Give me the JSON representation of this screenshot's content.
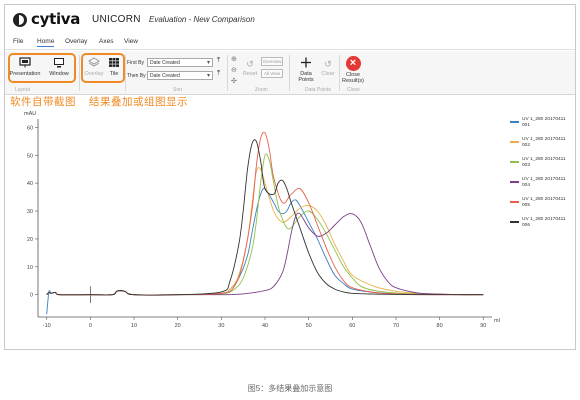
{
  "app": {
    "brand": "cytiva",
    "product": "UNICORN",
    "document_title": "Evaluation - New Comparison"
  },
  "menu": [
    "File",
    "Home",
    "Overlay",
    "Axes",
    "View"
  ],
  "ribbon": {
    "presentation_label": "Presentation",
    "window_label": "Window",
    "overlay_label": "Overlay",
    "tile_label": "Tile",
    "first_by_label": "First By",
    "first_by_value": "Date Created",
    "then_by_label": "Then By",
    "then_by_value": "Date Created",
    "reset_label": "Reset",
    "overview_label": "Overview",
    "all_view_label": "All View",
    "data_points_label": "Data Points",
    "clear_label": "Clear",
    "close_results_label": "Close Result(s)",
    "group_zoom": "Zoom",
    "group_data_points": "Data Points",
    "group_close": "Close",
    "group_layout": "Layout",
    "group_sort": "Sort"
  },
  "annotations": {
    "left": "软件自带截图",
    "right": "结果叠加或组图显示"
  },
  "caption": "图5：多结果叠加示意图",
  "colors": {
    "accent_orange": "#f08a24",
    "close_red": "#e53935"
  },
  "icons": [
    "presentation-icon",
    "monitor-icon",
    "layers-icon",
    "grid-icon",
    "sort-icon",
    "zoom-in-icon",
    "zoom-out-icon",
    "pan-icon",
    "reset-icon",
    "data-points-icon",
    "clear-icon",
    "close-icon"
  ],
  "chart_data": {
    "type": "line",
    "ylabel": "mAU",
    "xlabel": "ml",
    "xlim": [
      -12,
      92
    ],
    "ylim": [
      -8,
      63
    ],
    "xticks": [
      -10,
      0,
      10,
      20,
      30,
      40,
      50,
      60,
      70,
      80,
      90
    ],
    "yticks": [
      0,
      10,
      20,
      30,
      40,
      50,
      60
    ],
    "grid": false,
    "legend_position": "right",
    "series": [
      {
        "name": "UV 1_280 20170411 001",
        "color": "#3d7fc2",
        "x": [
          -10,
          -9.5,
          -9,
          -8,
          -7,
          0,
          5,
          6,
          7,
          8,
          10,
          20,
          30,
          32,
          34,
          36,
          37,
          38,
          39,
          40,
          42,
          43,
          44,
          45,
          46,
          47,
          48,
          50,
          52,
          54,
          56,
          58,
          60,
          65,
          70,
          75,
          80,
          85,
          90
        ],
        "y": [
          -7,
          1,
          0.5,
          0.8,
          0,
          0,
          0,
          1.2,
          1.5,
          1.1,
          0,
          0,
          0.5,
          2,
          6,
          14,
          22,
          30,
          36,
          38,
          33,
          30,
          29,
          30,
          33,
          34,
          32,
          26,
          20,
          13,
          7,
          4,
          2,
          0.8,
          0.4,
          0.2,
          0.1,
          0,
          0
        ]
      },
      {
        "name": "UV 1_280 20170411 002",
        "color": "#e9b04a",
        "x": [
          -10,
          -9.5,
          -9,
          -8,
          -7,
          0,
          5,
          6,
          7,
          8,
          10,
          20,
          30,
          32,
          34,
          36,
          37,
          38,
          39,
          40,
          42,
          44,
          46,
          48,
          50,
          52,
          54,
          56,
          58,
          60,
          65,
          70,
          75,
          80,
          85,
          90
        ],
        "y": [
          0,
          0.8,
          0.5,
          0.8,
          0,
          0,
          0,
          1.2,
          1.5,
          1.1,
          0,
          0,
          0.5,
          2,
          7,
          20,
          32,
          44,
          45,
          40,
          30,
          26,
          28,
          31,
          32,
          30,
          25,
          18,
          12,
          7,
          3,
          1.2,
          0.5,
          0.2,
          0,
          0
        ]
      },
      {
        "name": "UV 1_280 20170411 003",
        "color": "#8bc34a",
        "x": [
          -10,
          -9.5,
          -9,
          -8,
          -7,
          0,
          5,
          6,
          7,
          8,
          10,
          20,
          30,
          33,
          35,
          37,
          38,
          39,
          40,
          41,
          42,
          43,
          44,
          45,
          46,
          48,
          50,
          52,
          54,
          56,
          58,
          60,
          62,
          65,
          70,
          75,
          80,
          85,
          90
        ],
        "y": [
          0,
          0.8,
          0.5,
          0.8,
          0,
          0,
          0,
          1.2,
          1.5,
          1.1,
          0,
          0,
          0.3,
          2,
          6,
          16,
          26,
          40,
          50,
          48,
          40,
          32,
          27,
          24,
          24,
          28,
          30,
          27,
          22,
          16,
          10,
          6,
          3,
          1.5,
          0.6,
          0.2,
          0.1,
          0,
          0
        ]
      },
      {
        "name": "UV 1_280 20170411 004",
        "color": "#7b3f8c",
        "x": [
          -10,
          -9.5,
          -9,
          -8,
          -7,
          0,
          5,
          6,
          7,
          8,
          10,
          20,
          30,
          35,
          40,
          42,
          44,
          45,
          46,
          47,
          48,
          50,
          52,
          54,
          56,
          58,
          60,
          62,
          64,
          66,
          68,
          70,
          75,
          80,
          85,
          90
        ],
        "y": [
          0,
          0.8,
          0.5,
          0.8,
          0,
          0,
          0,
          1.2,
          1.5,
          1.1,
          0,
          0,
          0,
          0.3,
          1.5,
          3,
          8,
          14,
          22,
          28,
          29,
          24,
          21,
          22,
          25,
          28,
          29,
          26,
          18,
          10,
          5,
          2.5,
          0.6,
          0.2,
          0,
          0
        ]
      },
      {
        "name": "UV 1_280 20170411 005",
        "color": "#e8604c",
        "x": [
          -10,
          -9.5,
          -9,
          -8,
          -7,
          0,
          5,
          6,
          7,
          8,
          10,
          20,
          30,
          33,
          35,
          37,
          38,
          39,
          40,
          41,
          42,
          44,
          46,
          48,
          50,
          52,
          54,
          56,
          58,
          60,
          65,
          70,
          75,
          80,
          85,
          90
        ],
        "y": [
          0,
          0.8,
          0.5,
          0.8,
          0,
          0,
          0,
          1.2,
          1.5,
          1.1,
          0,
          0,
          0.5,
          3,
          12,
          30,
          46,
          56,
          58,
          52,
          42,
          33,
          36,
          38,
          33,
          25,
          17,
          10,
          5,
          2.5,
          0.8,
          0.3,
          0.1,
          0,
          0,
          0
        ]
      },
      {
        "name": "UV 1_280 20170411 006",
        "color": "#333333",
        "x": [
          -10,
          -9.5,
          -9,
          -8,
          -7,
          0,
          5,
          6,
          7,
          8,
          10,
          20,
          30,
          32,
          34,
          35,
          36,
          37,
          38,
          39,
          40,
          42,
          43,
          44,
          45,
          46,
          48,
          50,
          52,
          54,
          56,
          58,
          60,
          65,
          70,
          75,
          80,
          85,
          90
        ],
        "y": [
          0,
          0.8,
          0.5,
          0.8,
          0,
          0,
          0,
          1.2,
          1.5,
          1.1,
          0,
          0,
          1,
          5,
          18,
          30,
          45,
          54,
          55,
          48,
          38,
          36,
          40,
          41,
          38,
          33,
          24,
          15,
          8,
          4,
          2,
          1,
          0.5,
          0.2,
          0.1,
          0,
          0,
          0,
          0
        ]
      }
    ]
  }
}
